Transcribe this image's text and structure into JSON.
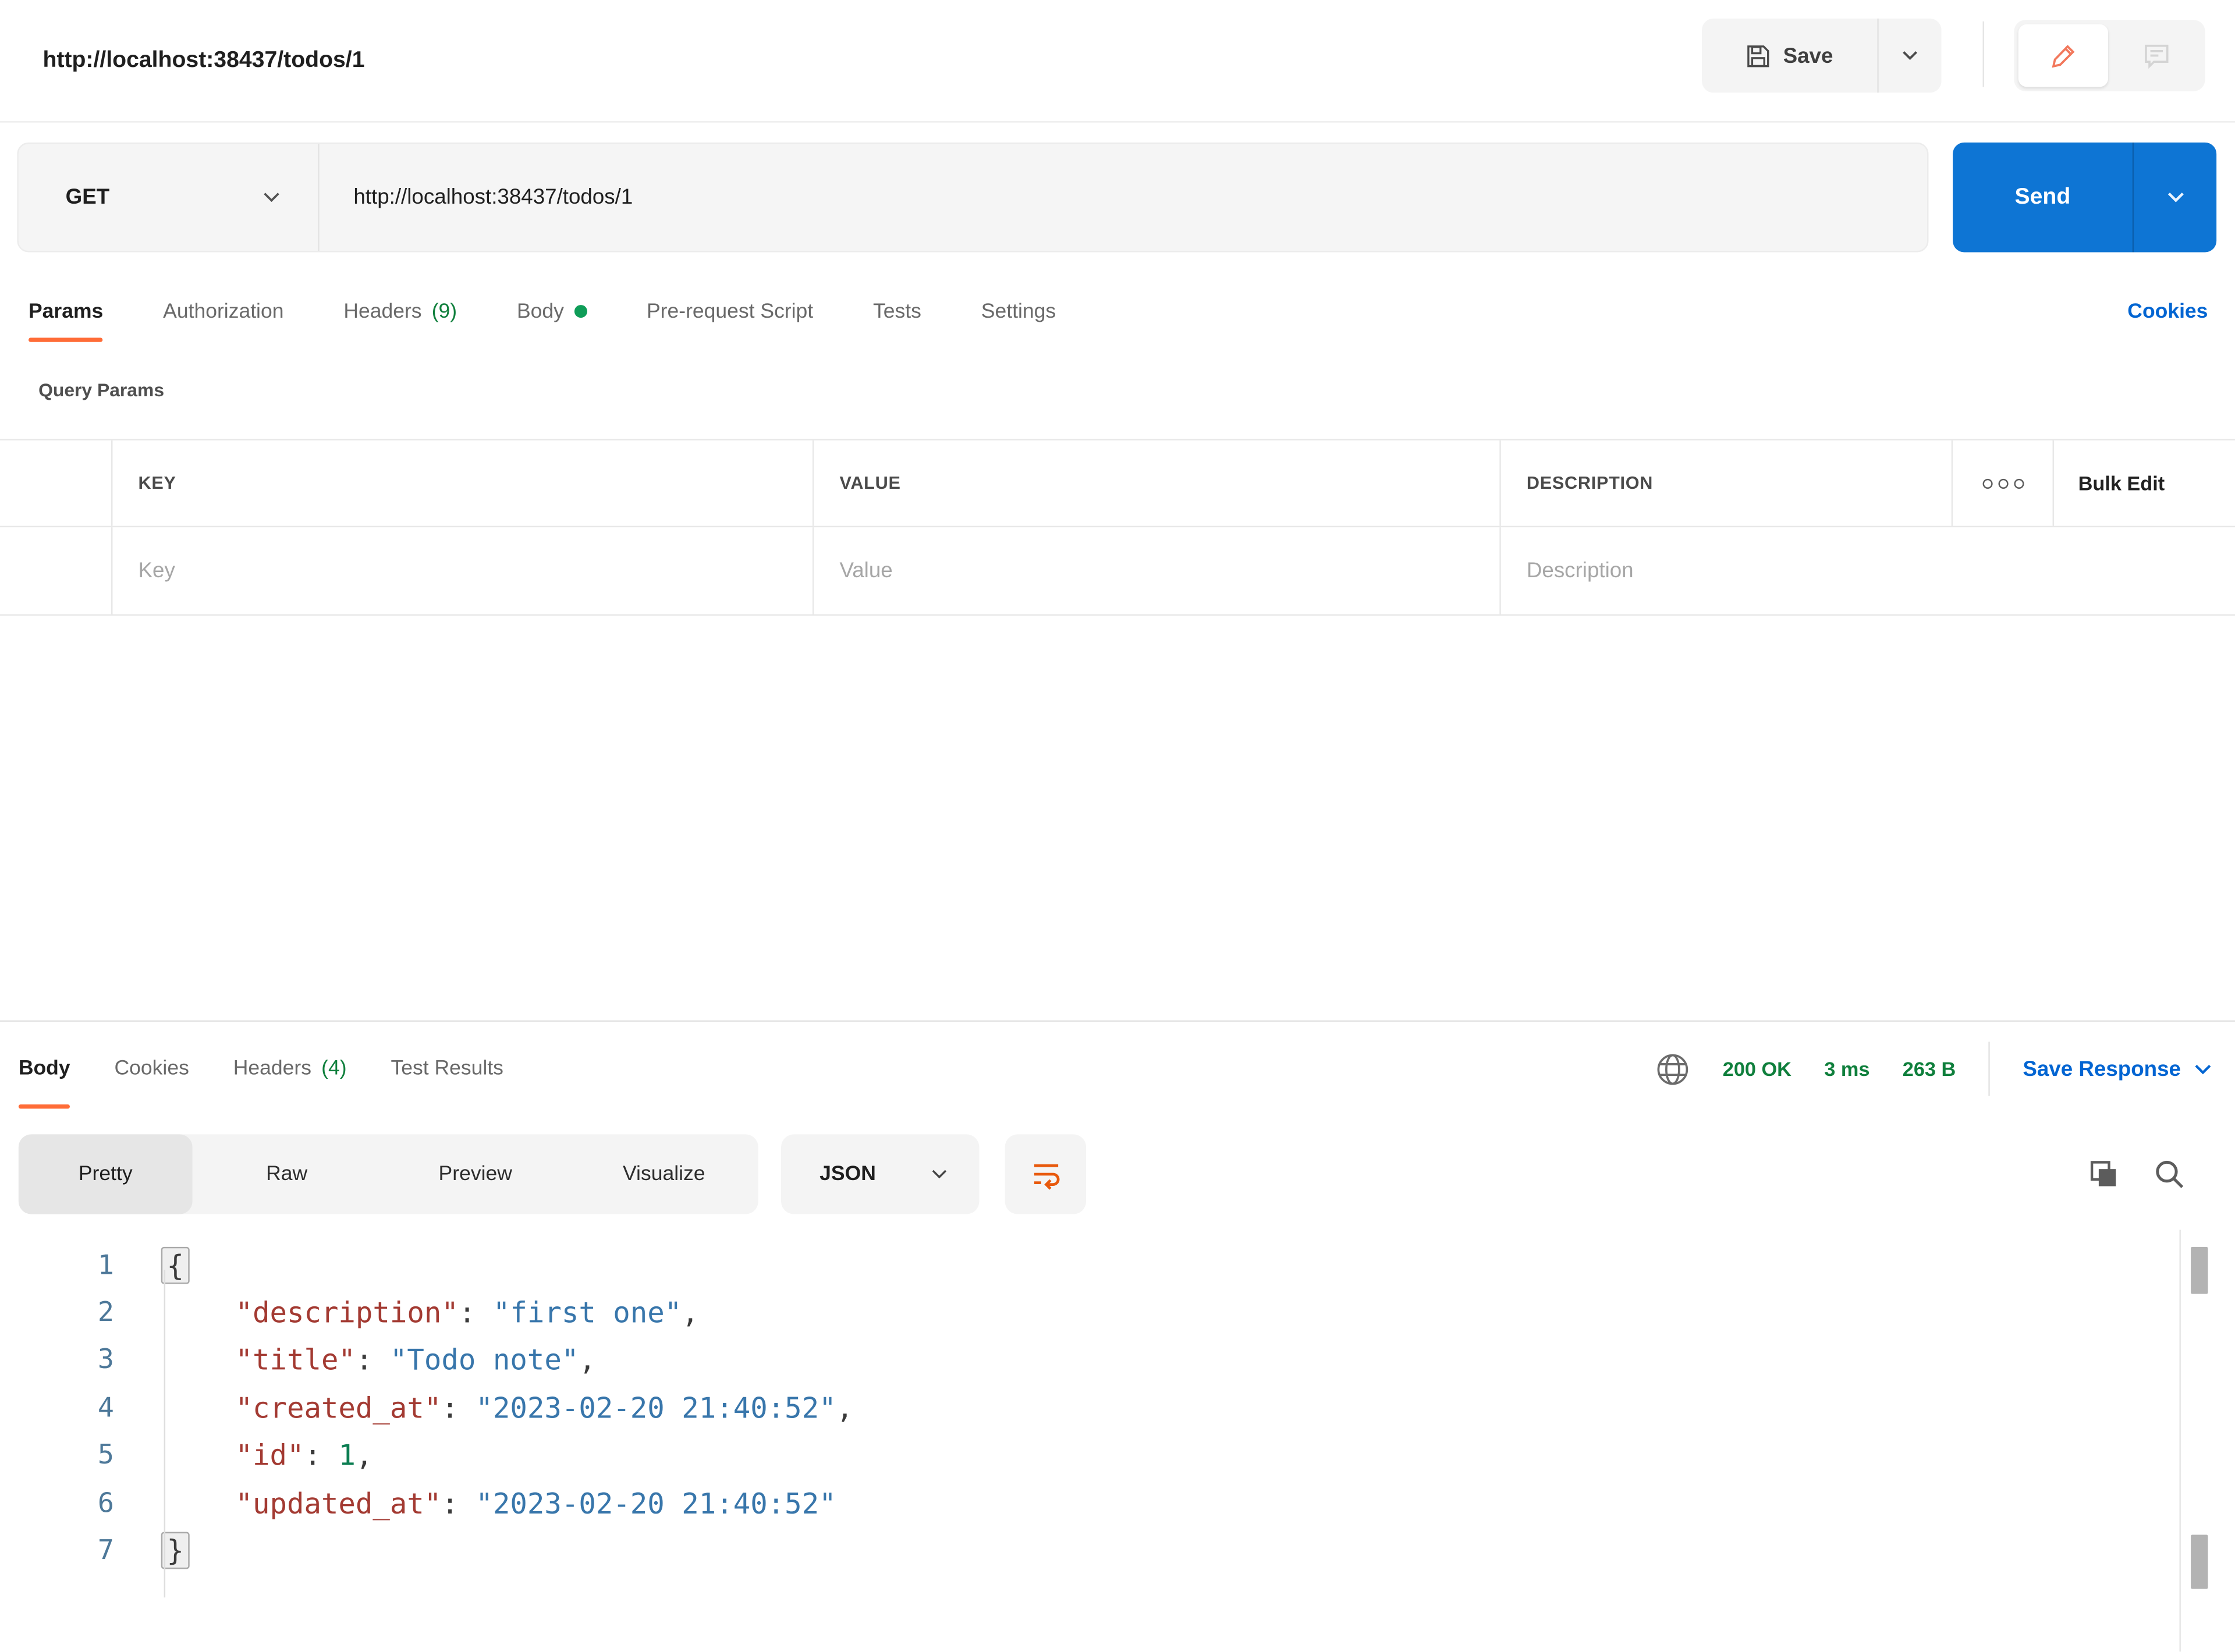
{
  "topbar": {
    "title": "http://localhost:38437/todos/1",
    "save_label": "Save"
  },
  "request": {
    "method": "GET",
    "url": "http://localhost:38437/todos/1",
    "send_label": "Send"
  },
  "request_tabs": {
    "items": [
      {
        "label": "Params",
        "active": true
      },
      {
        "label": "Authorization"
      },
      {
        "label": "Headers",
        "count": "(9)"
      },
      {
        "label": "Body",
        "modified": true
      },
      {
        "label": "Pre-request Script"
      },
      {
        "label": "Tests"
      },
      {
        "label": "Settings"
      }
    ],
    "cookies_link": "Cookies"
  },
  "query_params": {
    "title": "Query Params",
    "columns": {
      "key": "KEY",
      "value": "VALUE",
      "description": "DESCRIPTION"
    },
    "bulk_edit_label": "Bulk Edit",
    "row_placeholders": {
      "key": "Key",
      "value": "Value",
      "description": "Description"
    }
  },
  "response": {
    "tabs": [
      {
        "label": "Body",
        "active": true
      },
      {
        "label": "Cookies"
      },
      {
        "label": "Headers",
        "count": "(4)"
      },
      {
        "label": "Test Results"
      }
    ],
    "status": "200 OK",
    "time": "3 ms",
    "size": "263 B",
    "save_response_label": "Save Response"
  },
  "response_toolbar": {
    "views": [
      "Pretty",
      "Raw",
      "Preview",
      "Visualize"
    ],
    "active_view": "Pretty",
    "format": "JSON"
  },
  "response_body": {
    "language": "json",
    "lines": [
      {
        "num": "1",
        "tokens": [
          {
            "text": "{",
            "type": "brace"
          }
        ]
      },
      {
        "num": "2",
        "tokens": [
          {
            "text": "    ",
            "type": "plain"
          },
          {
            "text": "\"description\"",
            "type": "key"
          },
          {
            "text": ": ",
            "type": "plain"
          },
          {
            "text": "\"first one\"",
            "type": "string"
          },
          {
            "text": ",",
            "type": "plain"
          }
        ]
      },
      {
        "num": "3",
        "tokens": [
          {
            "text": "    ",
            "type": "plain"
          },
          {
            "text": "\"title\"",
            "type": "key"
          },
          {
            "text": ": ",
            "type": "plain"
          },
          {
            "text": "\"Todo note\"",
            "type": "string"
          },
          {
            "text": ",",
            "type": "plain"
          }
        ]
      },
      {
        "num": "4",
        "tokens": [
          {
            "text": "    ",
            "type": "plain"
          },
          {
            "text": "\"created_at\"",
            "type": "key"
          },
          {
            "text": ": ",
            "type": "plain"
          },
          {
            "text": "\"2023-02-20 21:40:52\"",
            "type": "string"
          },
          {
            "text": ",",
            "type": "plain"
          }
        ]
      },
      {
        "num": "5",
        "tokens": [
          {
            "text": "    ",
            "type": "plain"
          },
          {
            "text": "\"id\"",
            "type": "key"
          },
          {
            "text": ": ",
            "type": "plain"
          },
          {
            "text": "1",
            "type": "number"
          },
          {
            "text": ",",
            "type": "plain"
          }
        ]
      },
      {
        "num": "6",
        "tokens": [
          {
            "text": "    ",
            "type": "plain"
          },
          {
            "text": "\"updated_at\"",
            "type": "key"
          },
          {
            "text": ": ",
            "type": "plain"
          },
          {
            "text": "\"2023-02-20 21:40:52\"",
            "type": "string"
          }
        ]
      },
      {
        "num": "7",
        "tokens": [
          {
            "text": "}",
            "type": "brace"
          }
        ]
      }
    ]
  },
  "colors": {
    "accent_orange": "#ff6c37",
    "send_blue": "#0e75d4",
    "link_blue": "#0265d2",
    "success_green": "#0f7f3c",
    "code_key": "#a33a32",
    "code_string": "#3876ab",
    "code_number": "#0c7e52"
  }
}
